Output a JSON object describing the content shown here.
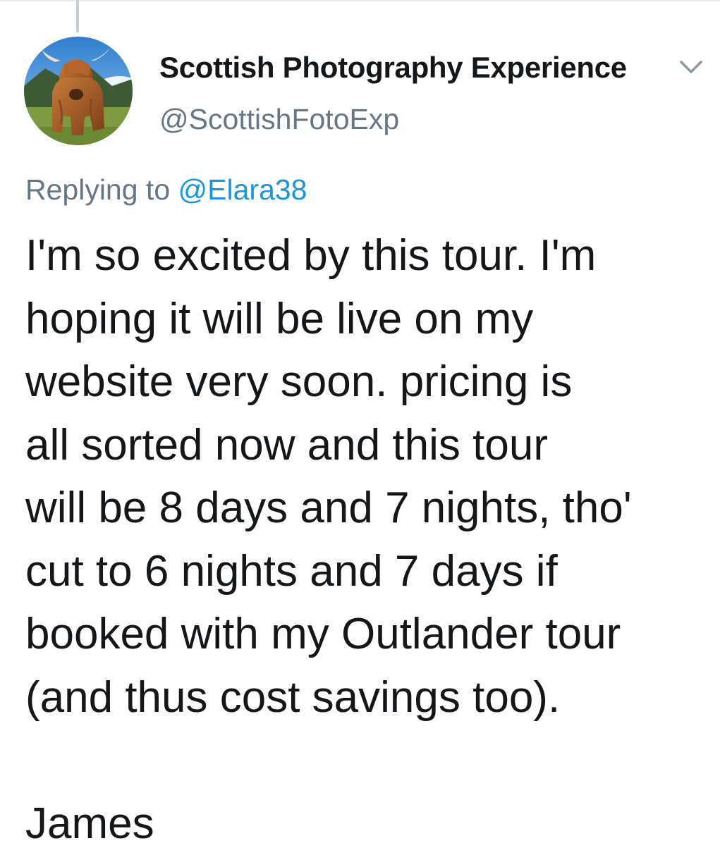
{
  "author": {
    "display_name": "Scottish Photography Experience",
    "handle": "@ScottishFotoExp",
    "avatar_icon": "highland-cow-avatar"
  },
  "reply": {
    "prefix": "Replying to",
    "mention": "@Elara38"
  },
  "tweet": {
    "lines": [
      "I'm so excited by this tour. I'm",
      "hoping it will be live on my",
      "website very soon. pricing is",
      "all sorted now and this tour",
      "will be 8 days and 7 nights, tho'",
      "cut to 6 nights and 7 days if",
      "booked with my Outlander tour",
      "(and thus cost savings too)."
    ],
    "signature": "James"
  },
  "colors": {
    "text": "#14171a",
    "secondary": "#657786",
    "link": "#1b95e0",
    "thread_line": "#c4cfd6"
  },
  "icons": {
    "menu": "chevron-down-icon"
  }
}
